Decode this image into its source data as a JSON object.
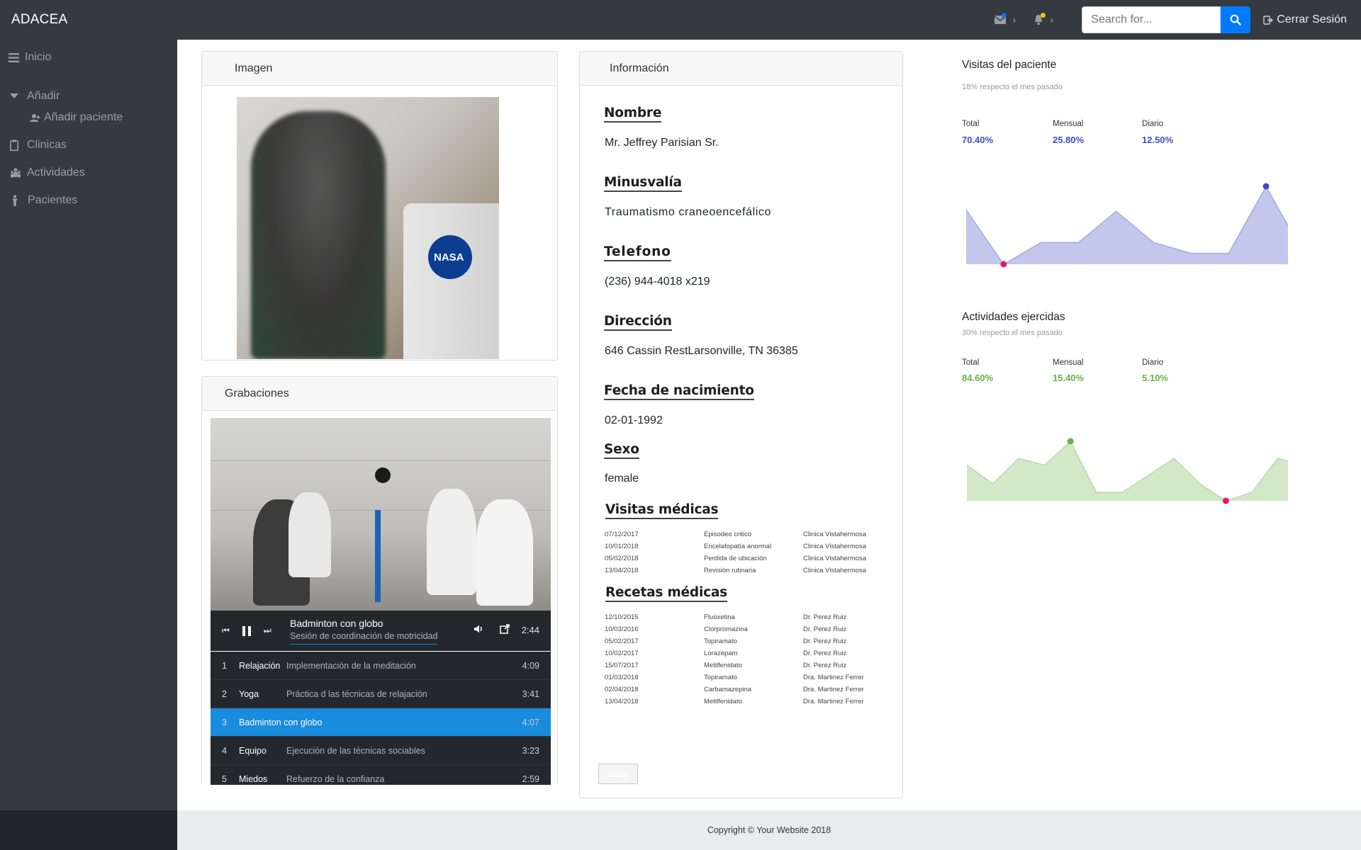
{
  "navbar": {
    "brand": "ADACEA",
    "search_placeholder": "Search for...",
    "logout_label": "Cerrar Sesión",
    "messages_dot_color": "#007bff",
    "alerts_dot_color": "#ffc107"
  },
  "sidebar": {
    "items": [
      {
        "label": "Inicio",
        "icon": "bars-icon"
      },
      {
        "label": "Añadir",
        "icon": "caret-down-icon"
      },
      {
        "label": "Añadir paciente",
        "icon": "user-plus-icon"
      },
      {
        "label": "Clinicas",
        "icon": "clipboard-icon"
      },
      {
        "label": "Actividades",
        "icon": "people-icon"
      },
      {
        "label": "Pacientes",
        "icon": "person-icon"
      }
    ]
  },
  "image_card": {
    "title": "Imagen",
    "photo_text": "NASA"
  },
  "recordings": {
    "title": "Grabaciones",
    "now_playing": {
      "title": "Badminton con globo",
      "subtitle": "Sesión de coordinación de motricidad",
      "time": "2:44"
    },
    "playlist": [
      {
        "num": "1",
        "title": "Relajación",
        "desc": "Implementación de la meditación",
        "dur": "4:09",
        "active": false
      },
      {
        "num": "2",
        "title": "Yoga",
        "desc": "Práctica d las técnicas de relajación",
        "dur": "3:41",
        "active": false
      },
      {
        "num": "3",
        "title": "Badminton con globo",
        "desc": "",
        "dur": "4:07",
        "active": true
      },
      {
        "num": "4",
        "title": "Equipo",
        "desc": "Ejecución de las técnicas sociables",
        "dur": "3:23",
        "active": false
      },
      {
        "num": "5",
        "title": "Miedos",
        "desc": "Refuerzo de la confianza",
        "dur": "2:59",
        "active": false
      }
    ]
  },
  "info": {
    "title": "Información",
    "fields": {
      "nombre_label": "Nombre",
      "nombre": "Mr. Jeffrey Parisian Sr.",
      "minusvalia_label": "Minusvalía",
      "minusvalia": "Traumatismo craneoencefálico",
      "telefono_label": "Telefono",
      "telefono": "(236) 944-4018 x219",
      "direccion_label": "Dirección",
      "direccion": "646 Cassin RestLarsonville, TN 36385",
      "fecha_label": "Fecha de nacimiento",
      "fecha": "02-01-1992",
      "sexo_label": "Sexo",
      "sexo": "female"
    },
    "visitas_title": "Visitas médicas",
    "visitas": [
      [
        "07/12/2017",
        "Episodeo critico",
        "Clinica Vistahermosa"
      ],
      [
        "10/01/2018",
        "Encelafopatía anormal",
        "Clinica Vistahermosa"
      ],
      [
        "05/02/2018",
        "Perdida de ubicación",
        "Clinica Vistahermosa"
      ],
      [
        "13/04/2018",
        "Revisión rutinaria",
        "Clinica Vistahermosa"
      ]
    ],
    "recetas_title": "Recetas médicas",
    "recetas": [
      [
        "12/10/2015",
        "Fluoxetina",
        "Dr. Perez Ruiz"
      ],
      [
        "10/03/2016",
        "Clorpromazina",
        "Dr. Perez Ruiz"
      ],
      [
        "05/02/2017",
        "Topiramato",
        "Dr. Perez Ruiz"
      ],
      [
        "10/02/2017",
        "Lorazepam",
        "Dr. Perez Ruiz"
      ],
      [
        "15/07/2017",
        "Metilfenidato",
        "Dr. Perez Ruiz"
      ],
      [
        "01/03/2018",
        "Topiramato",
        "Dra. Martinez Ferrer"
      ],
      [
        "02/04/2018",
        "Carbamazepina",
        "Dra. Martinez Ferrer"
      ],
      [
        "13/04/2018",
        "Metilfenidato",
        "Dra. Martinez Ferrer"
      ]
    ],
    "edit_label": "Editar"
  },
  "chart_data": [
    {
      "type": "area",
      "title": "Visitas del paciente",
      "subtitle": "18% respecto el mes pasado",
      "stats": [
        {
          "label": "Total",
          "value": "70.40%"
        },
        {
          "label": "Mensual",
          "value": "25.80%"
        },
        {
          "label": "Diario",
          "value": "12.50%"
        }
      ],
      "values": [
        3.5,
        0,
        1.4,
        1.4,
        3.4,
        1.4,
        0.7,
        0.7,
        5,
        0.7
      ],
      "ylim": [
        0,
        5
      ],
      "color": "#3a4fc4",
      "fill": "#c3c7ec",
      "markers": [
        {
          "index": 1,
          "color": "#e5195f"
        },
        {
          "index": 8,
          "color": "#3a4fc4"
        },
        {
          "index": 9,
          "color": "#8e98e0"
        }
      ]
    },
    {
      "type": "area",
      "title": "Actividades ejercidas",
      "subtitle": "30% respecto el mes pasado",
      "stats": [
        {
          "label": "Total",
          "value": "84.60%"
        },
        {
          "label": "Mensual",
          "value": "15.40%"
        },
        {
          "label": "Diario",
          "value": "5.10%"
        }
      ],
      "values": [
        2.1,
        1,
        2.5,
        2.1,
        3.5,
        0.5,
        0.5,
        1.5,
        2.5,
        1,
        0,
        0.5,
        2.5,
        2.1
      ],
      "ylim": [
        0,
        3.5
      ],
      "color": "#6ab04c",
      "fill": "#d2e8c6",
      "markers": [
        {
          "index": 4,
          "color": "#6ab04c"
        },
        {
          "index": 10,
          "color": "#e5195f"
        },
        {
          "index": 13,
          "color": "#a6d38b"
        }
      ]
    }
  ],
  "footer": {
    "copyright": "Copyright © Your Website 2018"
  }
}
